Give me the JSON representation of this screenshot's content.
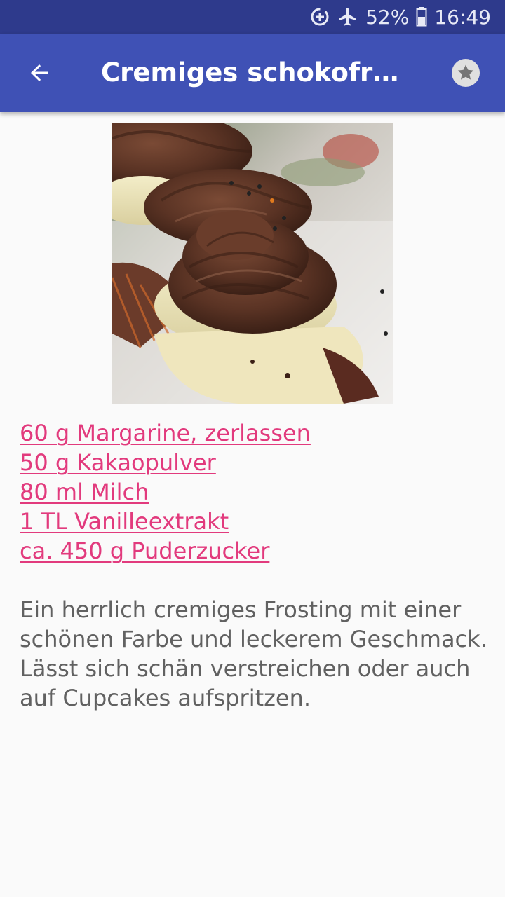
{
  "status_bar": {
    "battery": "52%",
    "time": "16:49",
    "icons": [
      "data-saver-icon",
      "airplane-mode-icon",
      "battery-icon"
    ]
  },
  "app_bar": {
    "title": "Cremiges schokofrosti…",
    "back_icon": "arrow-back-icon",
    "favorite_icon": "star-icon"
  },
  "recipe": {
    "image_subject": "chocolate-frosted-cupcakes",
    "ingredients": [
      "60 g Margarine, zerlassen",
      "50 g Kakaopulver",
      "80 ml Milch",
      "1 TL Vanilleextrakt",
      "ca. 450 g Puderzucker"
    ],
    "description": "Ein herrlich cremiges Frosting mit einer schönen Farbe und leckerem Geschmack. Lässt sich schän verstreichen oder auch auf Cupcakes aufspritzen."
  },
  "colors": {
    "status_bar": "#2e3a8c",
    "app_bar": "#3f51b5",
    "link": "#e23a7d",
    "body_text": "#616161",
    "background": "#fafafa"
  }
}
